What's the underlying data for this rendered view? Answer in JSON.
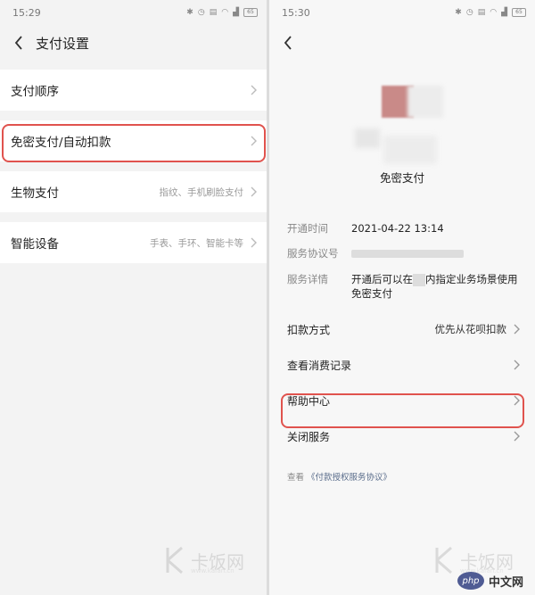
{
  "left": {
    "status_time": "15:29",
    "battery": "65",
    "title": "支付设置",
    "items": [
      {
        "label": "支付顺序",
        "value": ""
      },
      {
        "label": "免密支付/自动扣款",
        "value": ""
      },
      {
        "label": "生物支付",
        "value": "指纹、手机刷脸支付"
      },
      {
        "label": "智能设备",
        "value": "手表、手环、智能卡等"
      }
    ]
  },
  "right": {
    "status_time": "15:30",
    "battery": "65",
    "service_name": "免密支付",
    "info": [
      {
        "label": "开通时间",
        "value": "2021-04-22 13:14"
      },
      {
        "label": "服务协议号",
        "value": ""
      },
      {
        "label": "服务详情",
        "value_before": "开通后可以在",
        "value_after": "内指定业务场景使用免密支付"
      }
    ],
    "options": [
      {
        "label": "扣款方式",
        "value": "优先从花呗扣款"
      },
      {
        "label": "查看消费记录",
        "value": ""
      },
      {
        "label": "帮助中心",
        "value": ""
      },
      {
        "label": "关闭服务",
        "value": ""
      }
    ],
    "agreement_prefix": "查看",
    "agreement_link": "《付款授权服务协议》"
  },
  "watermark": {
    "text": "卡饭网",
    "url": "www.kafan.cn"
  },
  "badge": {
    "php": "php",
    "site": "中文网"
  },
  "colors": {
    "highlight": "#e0534e",
    "link": "#5b6e8c"
  }
}
